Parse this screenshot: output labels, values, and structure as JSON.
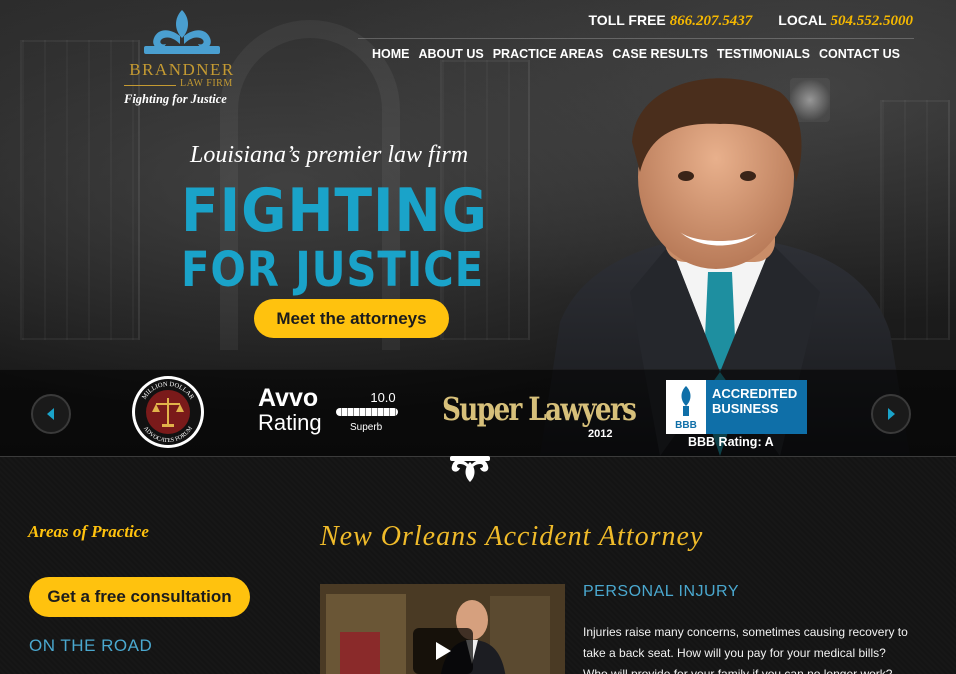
{
  "logo": {
    "name": "BRANDNER",
    "sub": "LAW FIRM",
    "tagline": "Fighting for Justice"
  },
  "header": {
    "toll_free_label": "TOLL FREE",
    "toll_free_number": "866.207.5437",
    "local_label": "LOCAL",
    "local_number": "504.552.5000"
  },
  "nav": {
    "items": [
      {
        "label": "HOME"
      },
      {
        "label": "ABOUT US"
      },
      {
        "label": "PRACTICE AREAS"
      },
      {
        "label": "CASE RESULTS"
      },
      {
        "label": "TESTIMONIALS"
      },
      {
        "label": "CONTACT US"
      }
    ]
  },
  "hero": {
    "tagline": "Louisiana’s premier law firm",
    "headline_line1": "FIGHTING",
    "headline_line2": "FOR JUSTICE",
    "cta": "Meet the attorneys"
  },
  "badges": {
    "mdaf_top": "MILLION DOLLAR",
    "mdaf_bottom": "ADVOCATES FORUM",
    "avvo_word1": "Avvo",
    "avvo_word2": "Rating",
    "avvo_score": "10.0",
    "avvo_label": "Superb",
    "superlawyers": "Super Lawyers",
    "superlawyers_year": "2012",
    "bbb_logo": "BBB",
    "bbb_text_line1": "ACCREDITED",
    "bbb_text_line2": "BUSINESS",
    "bbb_rating": "BBB Rating: A"
  },
  "sidebar": {
    "title": "Areas of Practice",
    "cta": "Get a free consultation",
    "section": "ON THE ROAD"
  },
  "main": {
    "title": "New Orleans Accident Attorney",
    "subheading": "PERSONAL INJURY",
    "body": "Injuries raise many concerns, sometimes causing recovery to take a back seat. How will you pay for your medical bills? Who will provide for your family if you can no longer work?"
  },
  "colors": {
    "accent_blue": "#1aa3c9",
    "accent_yellow": "#ffc20e",
    "gold": "#c49a32",
    "bbb_blue": "#0f6fa8"
  },
  "icons": [
    "fleur-de-lis-icon",
    "play-icon",
    "chevron-left-icon",
    "chevron-right-icon",
    "scales-of-justice-icon",
    "bbb-torch-icon"
  ]
}
